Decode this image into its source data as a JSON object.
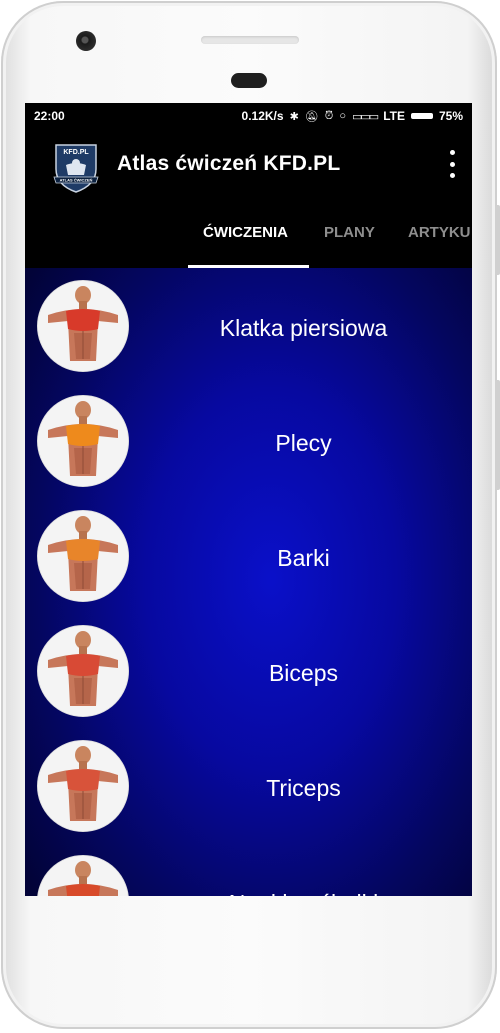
{
  "status_bar": {
    "time": "22:00",
    "speed": "0.12K/s",
    "network": "LTE",
    "battery": "75%",
    "icons": [
      "bluetooth-icon",
      "bell-off-icon",
      "alarm-icon",
      "circle-icon",
      "signal-icon"
    ]
  },
  "app_bar": {
    "title": "Atlas ćwiczeń KFD.PL",
    "logo_name": "kfd-logo",
    "logo_text_top": "KFD.PL",
    "logo_text_bottom": "ATLAS ĆWICZEŃ",
    "menu_icon": "more-vert-icon"
  },
  "tabs": [
    {
      "label": "ĆWICZENIA",
      "active": true
    },
    {
      "label": "PLANY",
      "active": false
    },
    {
      "label": "ARTYKU",
      "active": false
    }
  ],
  "categories": [
    {
      "label": "Klatka piersiowa",
      "highlight": "#d83a2a"
    },
    {
      "label": "Plecy",
      "highlight": "#ee8a1c"
    },
    {
      "label": "Barki",
      "highlight": "#e8852a"
    },
    {
      "label": "Biceps",
      "highlight": "#d84a35"
    },
    {
      "label": "Triceps",
      "highlight": "#d8533a"
    },
    {
      "label": "Nogi i pośladki",
      "highlight": "#d84a2a"
    }
  ],
  "colors": {
    "background_center": "#0a10c9",
    "background_edge": "#020338",
    "bar": "#000000",
    "tab_active": "#ffffff",
    "tab_inactive": "#8e8e8e"
  }
}
